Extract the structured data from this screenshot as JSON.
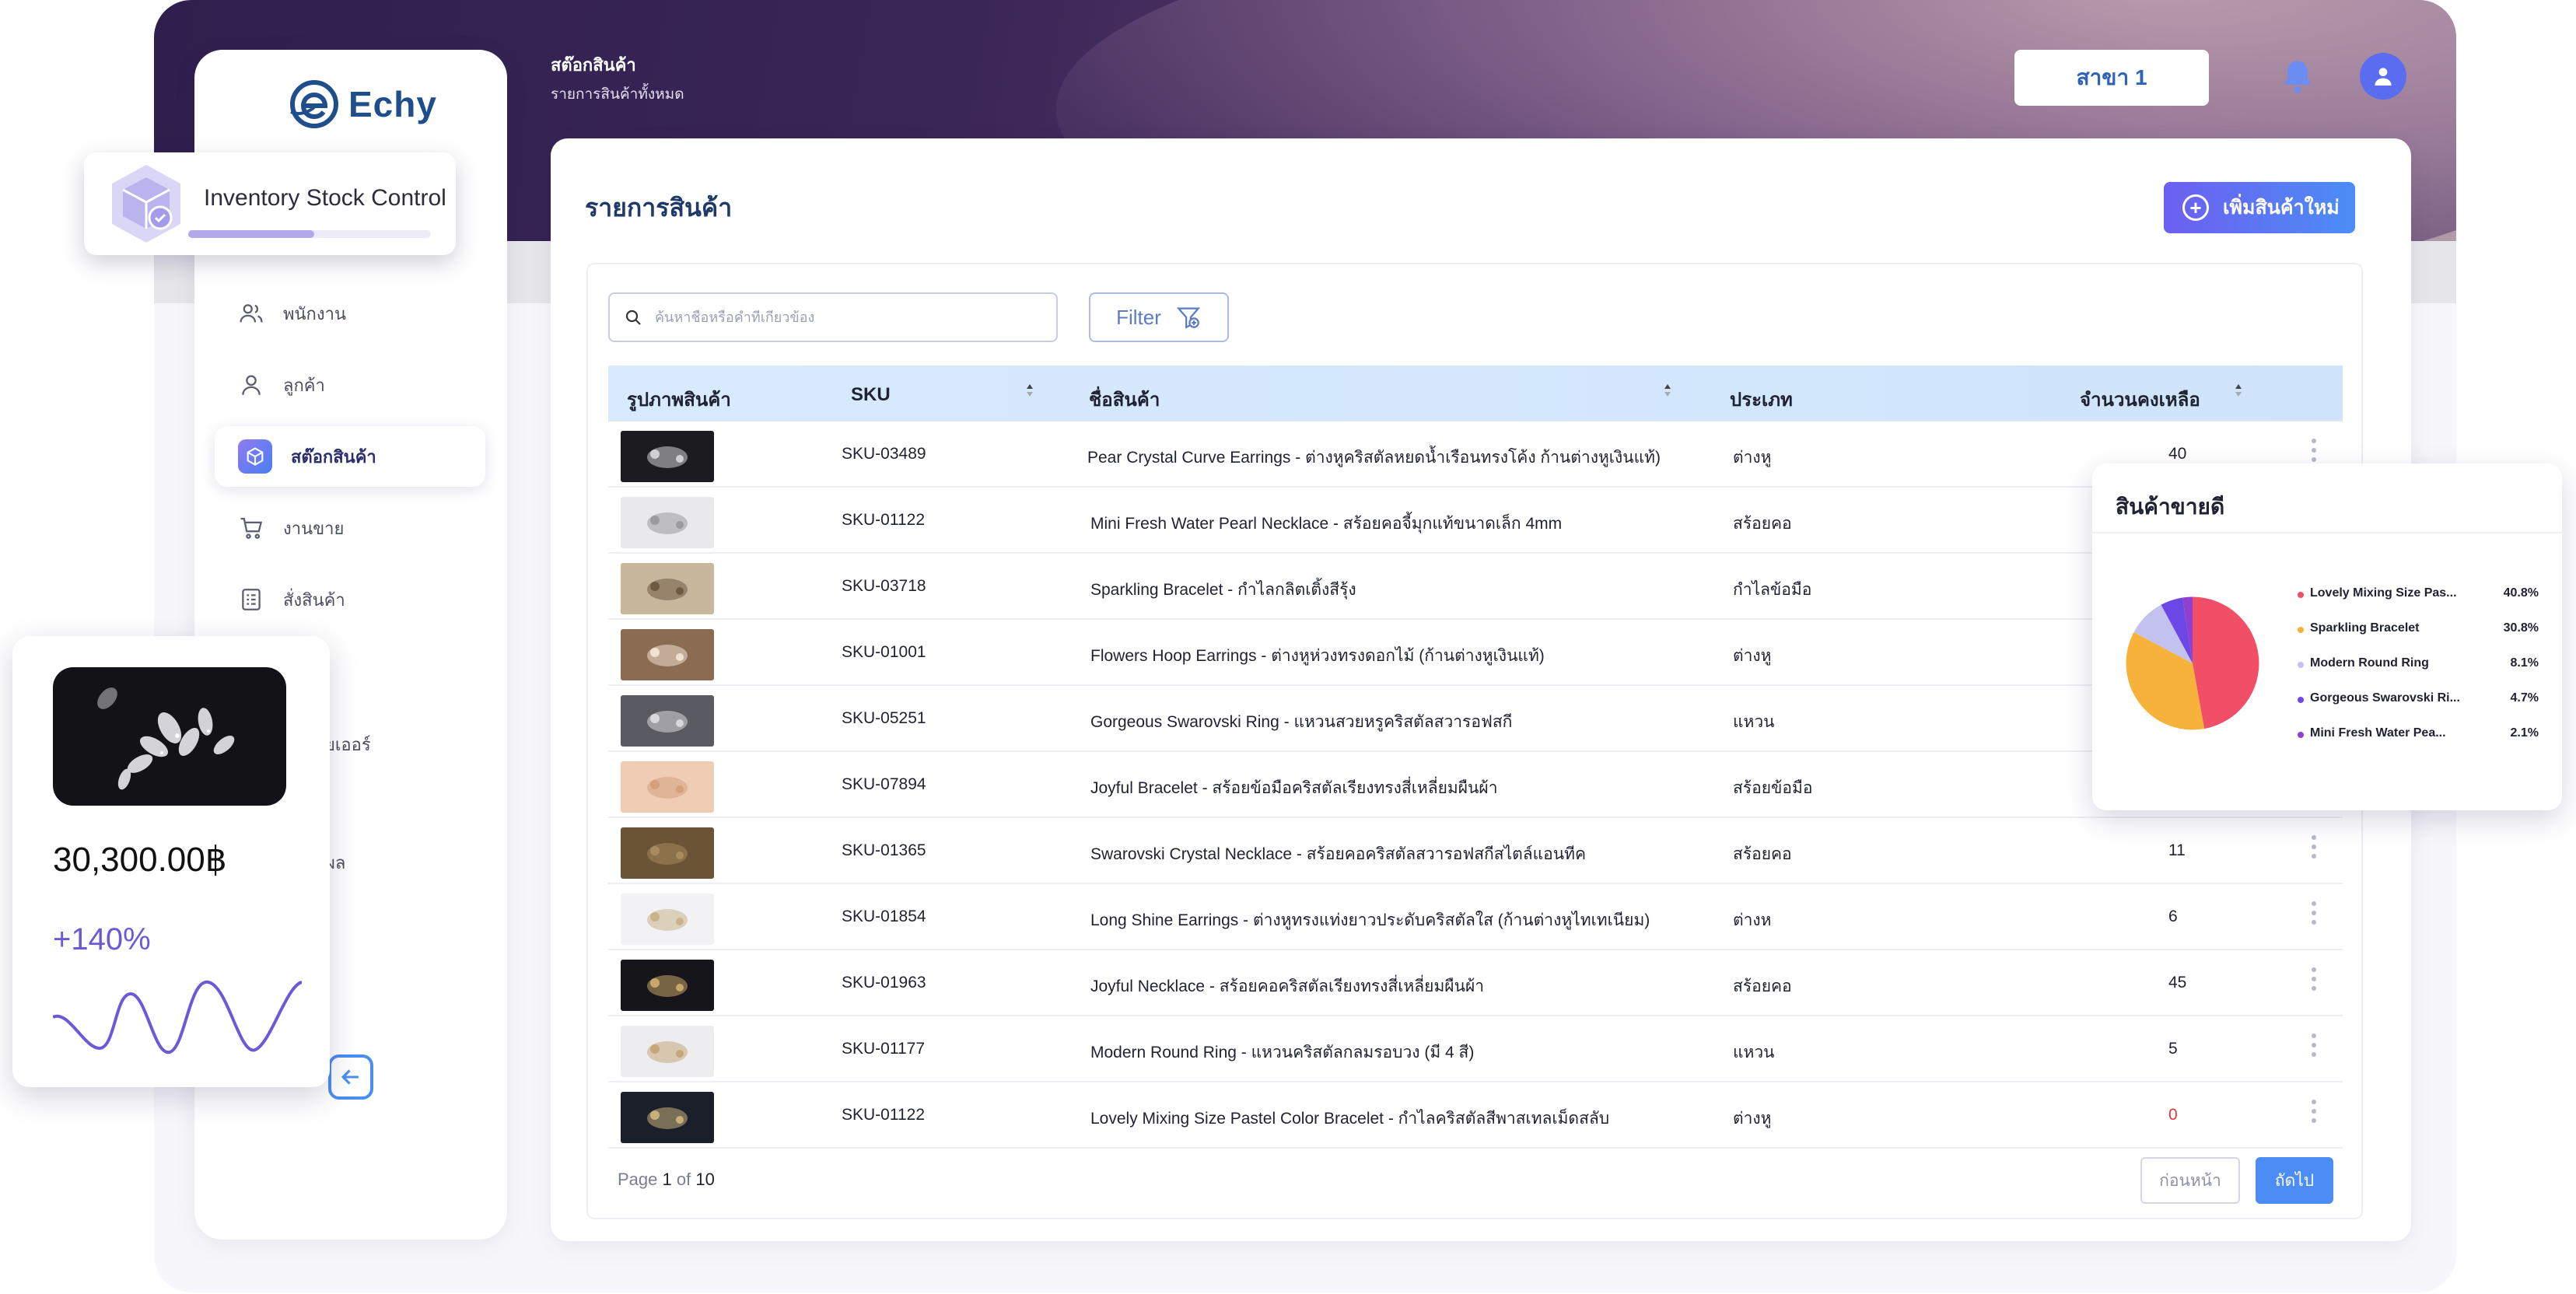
{
  "brand": {
    "name": "Echy"
  },
  "overlay_card": {
    "title": "Inventory Stock Control",
    "progress": 0.52
  },
  "header": {
    "title": "สต๊อกสินค้า",
    "subtitle": "รายการสินค้าทั้งหมด",
    "branch_label": "สาขา 1"
  },
  "sidebar": {
    "items": [
      {
        "label": "พนักงาน",
        "icon": "users-icon"
      },
      {
        "label": "ลูกค้า",
        "icon": "user-icon"
      },
      {
        "label": "สต๊อกสินค้า",
        "icon": "box-icon",
        "active": true
      },
      {
        "label": "งานขาย",
        "icon": "cart-icon"
      },
      {
        "label": "สั่งสินค้า",
        "icon": "clipboard-icon"
      }
    ],
    "partial_items": [
      "ยเออร์",
      "ผล"
    ]
  },
  "main": {
    "section_title": "รายการสินค้า",
    "add_button": "เพิ่มสินค้าใหม่",
    "search_placeholder": "ค้นหาชื่อหรือคำที่เกี่ยวข้อง",
    "filter_label": "Filter",
    "columns": [
      "รูปภาพสินค้า",
      "SKU",
      "ชื่อสินค้า",
      "ประเภท",
      "จำนวนคงเหลือ"
    ],
    "rows": [
      {
        "sku": "SKU-03489",
        "name": "Pear Crystal Curve Earrings",
        "desc": " - ต่างหูคริสตัลหยดน้ำเรือนทรงโค้ง ก้านต่างหูเงินแท้)",
        "type": "ต่างหู",
        "qty": "40"
      },
      {
        "sku": "SKU-01122",
        "name": "Mini Fresh Water Pearl Necklace",
        "desc": " - สร้อยคอจี้มุกแท้ขนาดเล็ก 4mm",
        "type": "สร้อยคอ",
        "qty": ""
      },
      {
        "sku": "SKU-03718",
        "name": "Sparkling Bracelet",
        "desc": " - กำไลกลิตเติ้งสีรุ้ง",
        "type": "กำไลข้อมือ",
        "qty": ""
      },
      {
        "sku": "SKU-01001",
        "name": "Flowers Hoop Earrings",
        "desc": " - ต่างหูห่วงทรงดอกไม้ (ก้านต่างหูเงินแท้)",
        "type": "ต่างหู",
        "qty": ""
      },
      {
        "sku": "SKU-05251",
        "name": "Gorgeous Swarovski Ring",
        "desc": " - แหวนสวยหรูคริสตัลสวารอฟสกี",
        "type": "แหวน",
        "qty": ""
      },
      {
        "sku": "SKU-07894",
        "name": "Joyful Bracelet",
        "desc": " - สร้อยข้อมือคริสตัลเรียงทรงสี่เหลี่ยมผืนผ้า",
        "type": "สร้อยข้อมือ",
        "qty": ""
      },
      {
        "sku": "SKU-01365",
        "name": "Swarovski Crystal Necklace",
        "desc": " - สร้อยคอคริสตัลสวารอฟสกีสไตล์แอนทีค",
        "type": "สร้อยคอ",
        "qty": "11"
      },
      {
        "sku": "SKU-01854",
        "name": "Long Shine Earrings",
        "desc": " - ต่างหูทรงแท่งยาวประดับคริสตัลใส (ก้านต่างหูไทเทเนียม)",
        "type": "ต่างห",
        "qty": "6"
      },
      {
        "sku": "SKU-01963",
        "name": "Joyful Necklace",
        "desc": " - สร้อยคอคริสตัลเรียงทรงสี่เหลี่ยมผืนผ้า",
        "type": "สร้อยคอ",
        "qty": "45"
      },
      {
        "sku": "SKU-01177",
        "name": "Modern Round Ring",
        "desc": " - แหวนคริสตัลกลมรอบวง (มี 4 สี)",
        "type": "แหวน",
        "qty": "5"
      },
      {
        "sku": "SKU-01122",
        "name": "Lovely Mixing Size Pastel Color Bracelet",
        "desc": " - กำไลคริสตัลสีพาสเทลเม็ดสลับ",
        "type": "ต่างหู",
        "qty": "0",
        "qty_alert": true
      }
    ],
    "pagination": {
      "prefix": "Page",
      "current": "1",
      "of_label": "of",
      "total": "10",
      "prev": "ก่อนหน้า",
      "next": "ถัดไป"
    }
  },
  "best_sellers": {
    "title": "สินค้าขายดี",
    "chart_data": {
      "type": "pie",
      "labels": [
        "Lovely Mixing Size Pas...",
        "Sparkling Bracelet",
        "Modern Round Ring",
        "Gorgeous Swarovski Ri...",
        "Mini Fresh Water Pea..."
      ],
      "values": [
        40.8,
        30.8,
        8.1,
        4.7,
        2.1
      ],
      "display_values": [
        "40.8%",
        "30.8%",
        "8.1%",
        "4.7%",
        "2.1%"
      ],
      "colors": [
        "#f14e68",
        "#f7b23b",
        "#c3c1ee",
        "#6b47e6",
        "#8e3fd0"
      ]
    }
  },
  "sales_card": {
    "amount": "30,300.00฿",
    "change": "+140%"
  },
  "colors": {
    "accent": "#4c8df5",
    "purple": "#6d5ff0",
    "alert": "#e53935"
  }
}
